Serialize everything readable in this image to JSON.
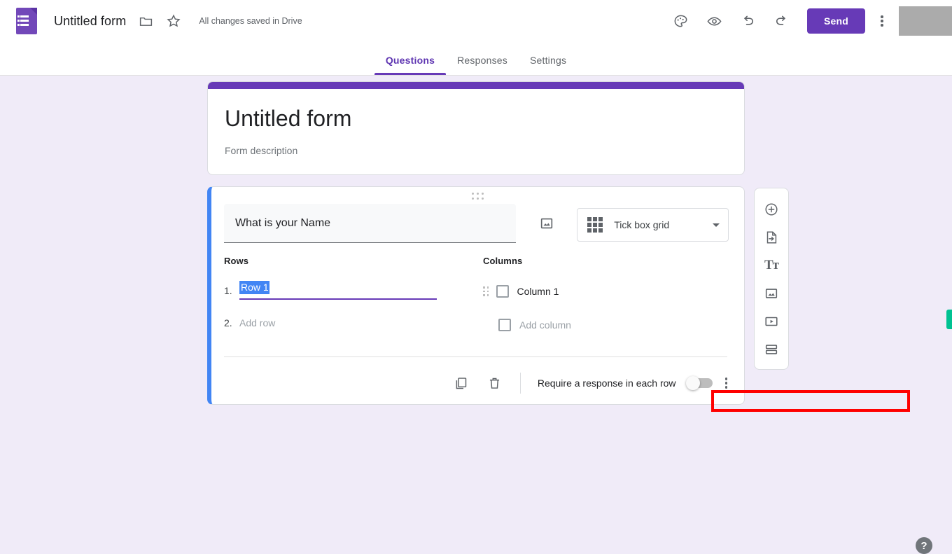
{
  "app": {
    "logo_icon": "google-forms-logo",
    "doc_title": "Untitled form",
    "folder_icon": "folder-icon",
    "star_icon": "star-icon",
    "save_status": "All changes saved in Drive",
    "theme_icon": "palette-icon",
    "preview_icon": "eye-preview-icon",
    "undo_icon": "undo-icon",
    "redo_icon": "redo-icon",
    "send_label": "Send",
    "more_icon": "more-vertical-icon"
  },
  "tabs": [
    {
      "label": "Questions",
      "active": true
    },
    {
      "label": "Responses",
      "active": false
    },
    {
      "label": "Settings",
      "active": false
    }
  ],
  "form_header": {
    "title": "Untitled form",
    "description": "Form description",
    "accent_color": "#673AB7"
  },
  "question": {
    "drag_handle_icon": "drag-handle-icon",
    "title": "What is your Name",
    "image_icon": "add-image-icon",
    "type": {
      "icon": "grid-icon",
      "label": "Tick box grid",
      "caret_icon": "chevron-down-icon"
    },
    "rows": {
      "heading": "Rows",
      "items": [
        {
          "number": "1.",
          "value": "Row 1",
          "selected": true
        }
      ],
      "add_number": "2.",
      "add_label": "Add row"
    },
    "columns": {
      "heading": "Columns",
      "items": [
        {
          "value": "Column 1",
          "checkbox_icon": "checkbox-unchecked-icon",
          "drag_icon": "drag-handle-icon",
          "highlighted": true
        }
      ],
      "add_label": "Add column",
      "add_checkbox_icon": "checkbox-unchecked-icon"
    },
    "footer": {
      "duplicate_icon": "duplicate-icon",
      "delete_icon": "trash-icon",
      "require_label": "Require a response in each row",
      "toggle_state": "off",
      "more_icon": "more-vertical-icon"
    }
  },
  "side_toolbar": {
    "items": [
      {
        "icon": "add-question-icon"
      },
      {
        "icon": "import-questions-icon"
      },
      {
        "icon": "add-title-description-icon",
        "glyph": "Tт"
      },
      {
        "icon": "add-image-icon"
      },
      {
        "icon": "add-video-icon"
      },
      {
        "icon": "add-section-icon"
      }
    ]
  },
  "help": {
    "label": "?",
    "icon": "help-icon"
  },
  "annotation": {
    "color": "#FF0000",
    "target": "column-1-input"
  }
}
